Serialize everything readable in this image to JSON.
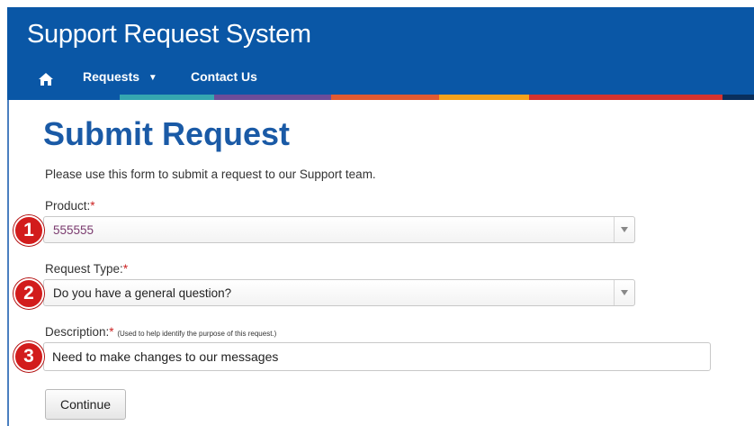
{
  "app": {
    "title": "Support Request System"
  },
  "nav": {
    "home_icon": "home-icon",
    "items": [
      {
        "label": "Requests",
        "has_dropdown": true
      },
      {
        "label": "Contact Us"
      }
    ]
  },
  "colors": {
    "header_bg": "#0a57a6",
    "title_blue": "#1a5aa6",
    "badge_red": "#d21c1c",
    "required_red": "#cc2222",
    "stripes": [
      "#0a57a6",
      "#35a7b0",
      "#6c4d99",
      "#e05a32",
      "#f5a21c",
      "#d4332f",
      "#0a2f5c"
    ]
  },
  "page": {
    "title": "Submit Request",
    "intro": "Please use this form to submit a request to our Support team."
  },
  "form": {
    "product": {
      "label": "Product:",
      "required_mark": "*",
      "value": "555555",
      "badge": "1"
    },
    "request_type": {
      "label": "Request Type:",
      "required_mark": "*",
      "value": "Do you have a general question?",
      "badge": "2"
    },
    "description": {
      "label": "Description:",
      "required_mark": "*",
      "hint": "(Used to help identify the purpose of this request.)",
      "value": "Need to make changes to our messages",
      "badge": "3"
    },
    "continue_label": "Continue"
  }
}
